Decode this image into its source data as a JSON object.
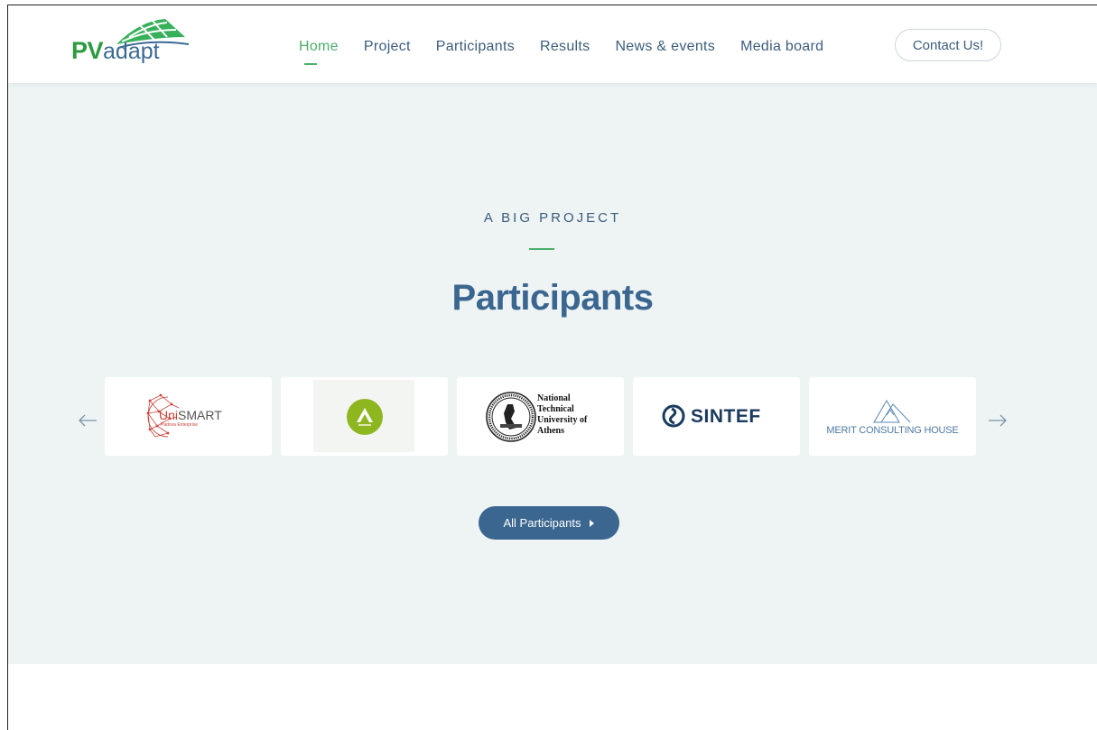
{
  "header": {
    "logo": {
      "pv": "PV",
      "adapt": "adapt"
    },
    "nav": [
      {
        "label": "Home",
        "active": true
      },
      {
        "label": "Project",
        "active": false
      },
      {
        "label": "Participants",
        "active": false
      },
      {
        "label": "Results",
        "active": false
      },
      {
        "label": "News & events",
        "active": false
      },
      {
        "label": "Media board",
        "active": false
      }
    ],
    "contact_label": "Contact Us!"
  },
  "section": {
    "eyebrow": "A BIG PROJECT",
    "title": "Participants",
    "participants": [
      {
        "name": "UniSMART",
        "uni": "Uni",
        "smart": "SMART",
        "sub": "Padova Enterprise"
      },
      {
        "name": "Green logo"
      },
      {
        "name": "National Technical University of Athens",
        "lines": [
          "National",
          "Technical",
          "University of",
          "Athens"
        ]
      },
      {
        "name": "SINTEF"
      },
      {
        "name": "MERIT CONSULTING HOUSE"
      }
    ],
    "all_button_label": "All Participants"
  },
  "colors": {
    "brand_blue": "#3b6690",
    "brand_green": "#4caf6a",
    "section_bg": "#eef3f4"
  }
}
